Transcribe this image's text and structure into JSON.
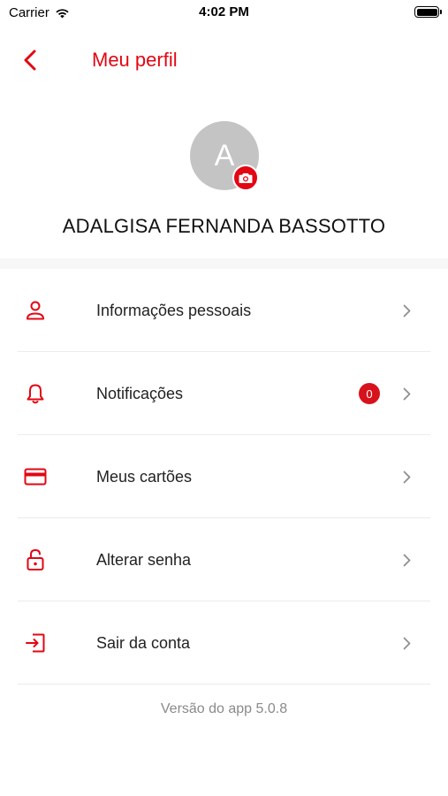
{
  "status_bar": {
    "carrier": "Carrier",
    "time": "4:02 PM"
  },
  "header": {
    "title": "Meu perfil"
  },
  "profile": {
    "avatar_initial": "A",
    "name": "ADALGISA FERNANDA BASSOTTO"
  },
  "menu": {
    "items": [
      {
        "label": "Informações pessoais",
        "icon": "person-icon"
      },
      {
        "label": "Notificações",
        "icon": "bell-icon",
        "badge": "0"
      },
      {
        "label": "Meus cartões",
        "icon": "credit-card-icon"
      },
      {
        "label": "Alterar senha",
        "icon": "padlock-icon"
      },
      {
        "label": "Sair da conta",
        "icon": "logout-icon"
      }
    ]
  },
  "footer": {
    "version": "Versão do app 5.0.8"
  },
  "colors": {
    "accent": "#e30613",
    "badge": "#d7121c",
    "avatar_bg": "#c4c4c4",
    "chevron": "#8e8e93",
    "muted_text": "#8a8a8a"
  }
}
